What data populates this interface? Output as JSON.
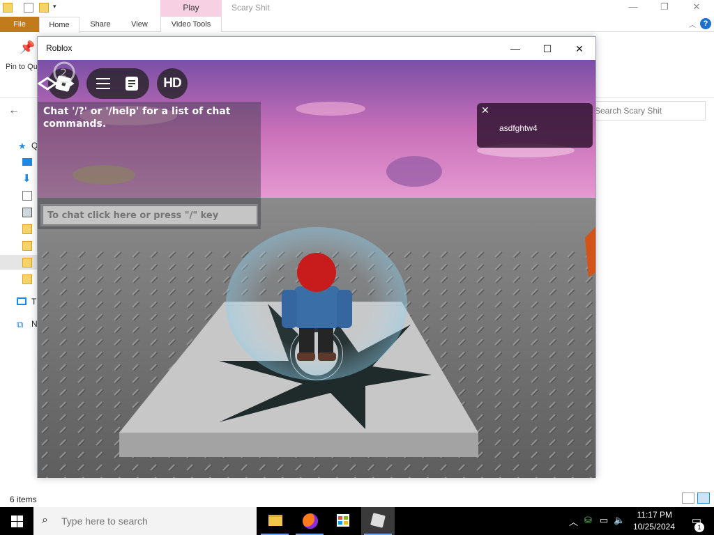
{
  "explorer": {
    "context_tab": "Play",
    "window_title": "Scary Shit",
    "tabs": [
      "File",
      "Home",
      "Share",
      "View",
      "Video Tools"
    ],
    "pin_label": "Pin to Quick access",
    "search_placeholder": "Search Scary Shit",
    "tree": [
      {
        "label": "Q",
        "icon": "star-icon"
      },
      {
        "label": "Th",
        "icon": "computer-icon"
      },
      {
        "label": "N",
        "icon": "network-icon"
      }
    ],
    "status_items": "6 items",
    "help": "?"
  },
  "roblox": {
    "title": "Roblox",
    "hd_label": "HD",
    "chat_message": "Chat '/?' or '/help' for a list of chat commands.",
    "chat_placeholder": "To chat click here or press \"/\" key",
    "notification_text": "asdfghtw4",
    "colors": {
      "sky_top": "#7b4fa8",
      "sky_bottom": "#e58ac6",
      "baseplate": "#6e6e6e",
      "platform": "#c9c9c9"
    }
  },
  "taskbar": {
    "search_placeholder": "Type here to search",
    "time": "11:17 PM",
    "date": "10/25/2024",
    "notification_count": "1",
    "apps": [
      "file-explorer-icon",
      "firefox-icon",
      "store-icon",
      "roblox-icon"
    ]
  }
}
